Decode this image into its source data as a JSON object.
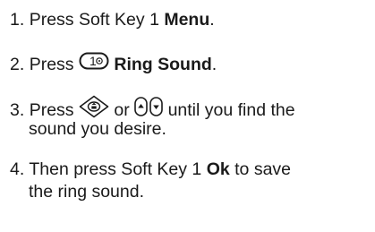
{
  "instructions": {
    "step1": {
      "num": "1.",
      "pre": "Press Soft Key 1",
      "bold": "Menu",
      "post": "."
    },
    "step2": {
      "num": "2.",
      "pre": "Press",
      "bold": "Ring Sound",
      "post": "."
    },
    "step3": {
      "num": "3.",
      "pre": "Press",
      "mid": "or",
      "post": "until you find the",
      "cont": "sound you desire."
    },
    "step4": {
      "num": "4.",
      "pre": "Then press Soft Key 1",
      "bold": "Ok",
      "post": "to save",
      "cont": "the ring sound."
    }
  },
  "icons": {
    "key_one": "key-1-button-icon",
    "nav": "navigation-key-icon",
    "up": "up-arrow-key-icon",
    "down": "down-arrow-key-icon"
  }
}
